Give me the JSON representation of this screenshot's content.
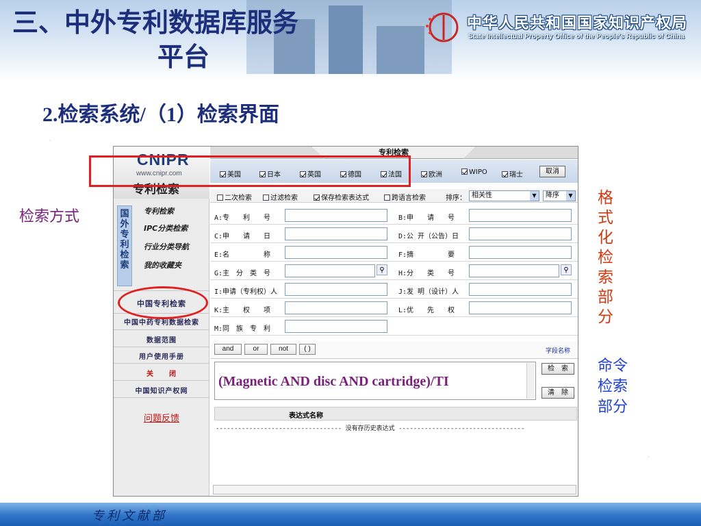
{
  "slide": {
    "title_line1": "三、中外专利数据库服务",
    "title_line2": "平台",
    "subtitle": "2.检索系统/（1）检索界面",
    "footer": "专利文献部"
  },
  "logo": {
    "cn": "中华人民共和国国家知识产权局",
    "en": "State Intellectual Property Office of the People's Republic of China"
  },
  "callouts": {
    "left": "检索方式",
    "right_format": "格式化检索部分",
    "right_command": "命令检索部分"
  },
  "sidebar": {
    "brand": "CNIPR",
    "url": "www.cnipr.com",
    "brand_cn": "专利检索",
    "vertical_tab": "国外专利检索",
    "menu": [
      "专利检索",
      "IPC分类检索",
      "行业分类导航",
      "我的收藏夹"
    ],
    "links": [
      "中国专利检索",
      "中国中药专利数据检索",
      "数据范围",
      "用户使用手册",
      "关　　闭",
      "中国知识产权网"
    ],
    "feedback": "问题反馈"
  },
  "main": {
    "tab_title": "专利检索",
    "countries": [
      "美国",
      "日本",
      "英国",
      "德国",
      "法国",
      "欧洲",
      "WIPO",
      "瑞士"
    ],
    "cancel": "取消",
    "options": [
      "二次检索",
      "过滤检索",
      "保存检索表达式",
      "跨语言检索"
    ],
    "options_checked": [
      false,
      false,
      true,
      false
    ],
    "sort_label": "排序：",
    "sort_value": "相关性",
    "order_value": "降序",
    "fields_left": [
      "A:专　　利　　号",
      "C:申　　请　　日",
      "E:名　　　　　称",
      "G:主　分　类　号",
      "I:申请（专利权）人",
      "K:主　　权　　项",
      "M:同　族　专　利"
    ],
    "fields_right": [
      "B:申　　请　　号",
      "D:公 开（公告）日",
      "F:摘　　　　　要",
      "H:分　　类　　号",
      "J:发 明（设计）人",
      "L:优　　先　　权"
    ],
    "ops": [
      "and",
      "or",
      "not",
      "( )"
    ],
    "field_names": "字段名称",
    "command_text": "(Magnetic AND disc AND cartridge)/TI",
    "search_btn": "检　索",
    "clear_btn": "清　除",
    "history_header": "表达式名称",
    "history_empty": "---------------------------------- 没有存历史表达式 ----------------------------------"
  },
  "colors": {
    "title": "#1d2f7a",
    "callout_left": "#7a1f7a",
    "callout_right_format": "#d23a12",
    "callout_right_command": "#1f3fd6",
    "highlight_red": "#e02020"
  }
}
